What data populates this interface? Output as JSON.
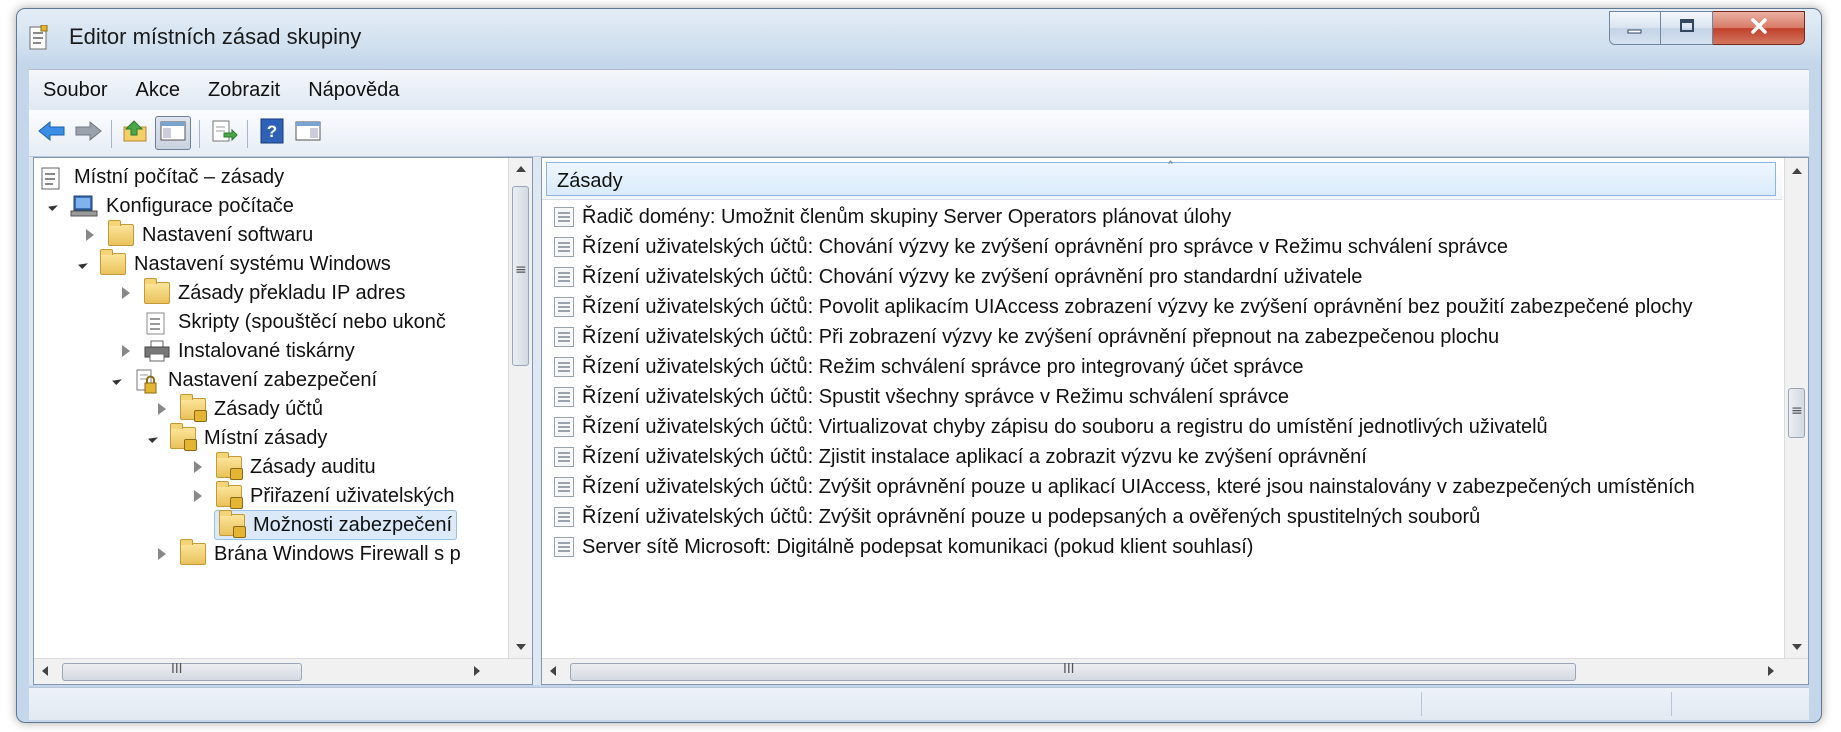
{
  "window": {
    "title": "Editor místních zásad skupiny"
  },
  "menu": [
    "Soubor",
    "Akce",
    "Zobrazit",
    "Nápověda"
  ],
  "toolbar": {
    "buttons": [
      "back-arrow-icon",
      "forward-arrow-icon",
      "up-folder-icon",
      "show-hide-tree-icon",
      "export-list-icon",
      "help-icon",
      "action-pane-icon"
    ]
  },
  "tree": {
    "items": [
      {
        "label": "Místní počítač – zásady"
      },
      {
        "label": "Konfigurace počítače"
      },
      {
        "label": "Nastavení softwaru"
      },
      {
        "label": "Nastavení systému Windows"
      },
      {
        "label": "Zásady překladu IP adres"
      },
      {
        "label": "Skripty (spouštěcí nebo ukonč"
      },
      {
        "label": "Instalované tiskárny"
      },
      {
        "label": "Nastavení zabezpečení"
      },
      {
        "label": "Zásady účtů"
      },
      {
        "label": "Místní zásady"
      },
      {
        "label": "Zásady auditu"
      },
      {
        "label": "Přiřazení uživatelských"
      },
      {
        "label": "Možnosti zabezpečení"
      },
      {
        "label": "Brána Windows Firewall s p"
      }
    ],
    "selected": "Možnosti zabezpečení",
    "hscroll_glyph": "III",
    "vscroll_glyph": "≡"
  },
  "list": {
    "column_header": "Zásady",
    "sort_glyph": "˄",
    "items": [
      "Řadič domény: Umožnit členům skupiny Server Operators plánovat úlohy",
      "Řízení uživatelských účtů: Chování výzvy ke zvýšení oprávnění pro správce v Režimu schválení správce",
      "Řízení uživatelských účtů: Chování výzvy ke zvýšení oprávnění pro standardní uživatele",
      "Řízení uživatelských účtů: Povolit aplikacím UIAccess zobrazení výzvy ke zvýšení oprávnění bez použití zabezpečené plochy",
      "Řízení uživatelských účtů: Při zobrazení výzvy ke zvýšení oprávnění přepnout na zabezpečenou plochu",
      "Řízení uživatelských účtů: Režim schválení správce pro integrovaný účet správce",
      "Řízení uživatelských účtů: Spustit všechny správce v Režimu schválení správce",
      "Řízení uživatelských účtů: Virtualizovat chyby zápisu do souboru a registru do umístění jednotlivých uživatelů",
      "Řízení uživatelských účtů: Zjistit instalace aplikací a zobrazit výzvu ke zvýšení oprávnění",
      "Řízení uživatelských účtů: Zvýšit oprávnění pouze u aplikací UIAccess, které jsou nainstalovány v zabezpečených umístěních",
      "Řízení uživatelských účtů: Zvýšit oprávnění pouze u podepsaných a ověřených spustitelných souborů",
      "Server sítě Microsoft: Digitálně podepsat komunikaci (pokud klient souhlasí)"
    ],
    "hscroll_glyph": "III",
    "vscroll_glyph": "≡"
  },
  "colors": {
    "accent": "#3c7fc4",
    "frame": "#c3d6ea",
    "close": "#c0402a"
  }
}
